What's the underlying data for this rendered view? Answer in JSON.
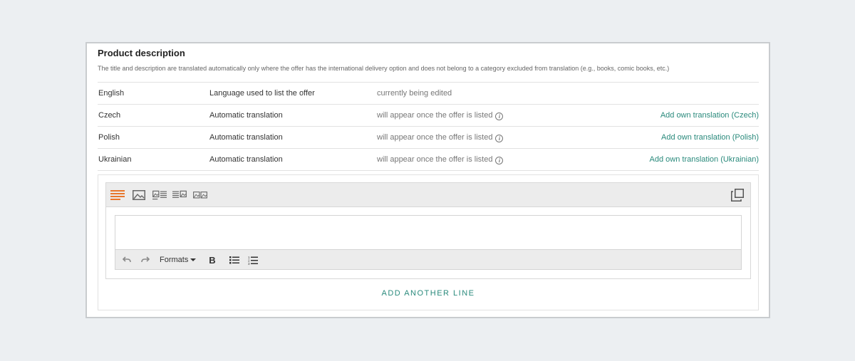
{
  "section": {
    "title": "Product description",
    "subtitle": "The title and description are translated automatically only where the offer has the international delivery option and does not belong to a category excluded from translation (e.g., books, comic books, etc.)"
  },
  "languages": [
    {
      "lang": "English",
      "mode": "Language used to list the offer",
      "status": "currently being edited",
      "action": ""
    },
    {
      "lang": "Czech",
      "mode": "Automatic translation",
      "status": "will appear once the offer is listed",
      "action": "Add own translation (Czech)"
    },
    {
      "lang": "Polish",
      "mode": "Automatic translation",
      "status": "will appear once the offer is listed",
      "action": "Add own translation (Polish)"
    },
    {
      "lang": "Ukrainian",
      "mode": "Automatic translation",
      "status": "will appear once the offer is listed",
      "action": "Add own translation (Ukrainian)"
    }
  ],
  "info_glyph": "i",
  "editor": {
    "layout_icons": [
      "text-only-layout-icon",
      "image-only-layout-icon",
      "image-text-layout-icon",
      "text-image-layout-icon",
      "two-images-layout-icon"
    ],
    "active_layout": "text-only-layout-icon",
    "duplicate_icon": "copy-icon",
    "formats_label": "Formats",
    "bold_label": "B",
    "content": ""
  },
  "add_line_label": "ADD ANOTHER LINE",
  "colors": {
    "accent": "#2a8a7c",
    "active_layout": "#e8762b"
  }
}
